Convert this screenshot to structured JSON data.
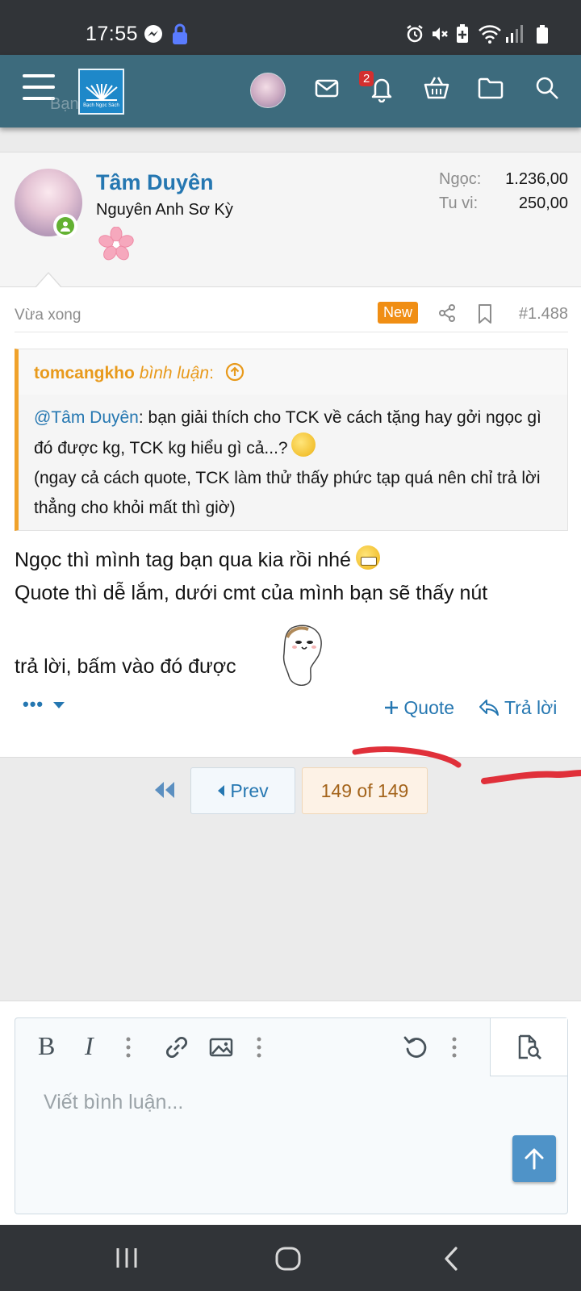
{
  "status_bar": {
    "time": "17:55",
    "icons": [
      "messenger-icon",
      "lock-icon",
      "alarm-icon",
      "mute-icon",
      "battery-saver-icon",
      "wifi-icon",
      "signal-icon",
      "battery-icon"
    ]
  },
  "header": {
    "logo_text": "Bạch Ngọc Sách",
    "notification_count": "2",
    "icons": [
      "menu-icon",
      "logo",
      "avatar",
      "mail-icon",
      "bell-icon",
      "basket-icon",
      "folder-icon",
      "search-icon"
    ],
    "ghost_text": "Bạn"
  },
  "post": {
    "author": "Tâm Duyên",
    "user_title": "Nguyên Anh Sơ Kỳ",
    "stats": [
      {
        "label": "Ngọc:",
        "value": "1.236,00"
      },
      {
        "label": "Tu vi:",
        "value": "250,00"
      }
    ],
    "time": "Vừa xong",
    "new_badge": "New",
    "post_number": "#1.488",
    "quote": {
      "author": "tomcangkho",
      "verb": "bình luận",
      "colon": ":",
      "mention": "@Tâm Duyên",
      "text1": ": bạn giải thích cho TCK về cách tặng hay gởi ngọc gì đó được kg, TCK kg hiểu gì cả...?",
      "text2": "(ngay cả cách quote, TCK làm thử thấy phức tạp quá nên chỉ trả lời thẳng cho khỏi mất thì giờ)"
    },
    "message": {
      "line1": "Ngọc thì mình tag bạn qua kia rồi nhé",
      "line2": "Quote thì dễ lắm, dưới cmt của mình bạn sẽ thấy nút",
      "line3": "trả lời, bấm vào đó được"
    },
    "actions": {
      "more": "•••",
      "quote": "Quote",
      "reply": "Trả lời"
    }
  },
  "pagination": {
    "prev": "Prev",
    "current": "149 of 149"
  },
  "editor": {
    "placeholder": "Viết bình luận...",
    "bold": "B",
    "italic": "I"
  },
  "colors": {
    "header_bg": "#3d6b7d",
    "link_blue": "#2577b1",
    "quote_orange": "#e89a1c",
    "new_badge": "#f08e14",
    "annotation_red": "#e0303a"
  }
}
